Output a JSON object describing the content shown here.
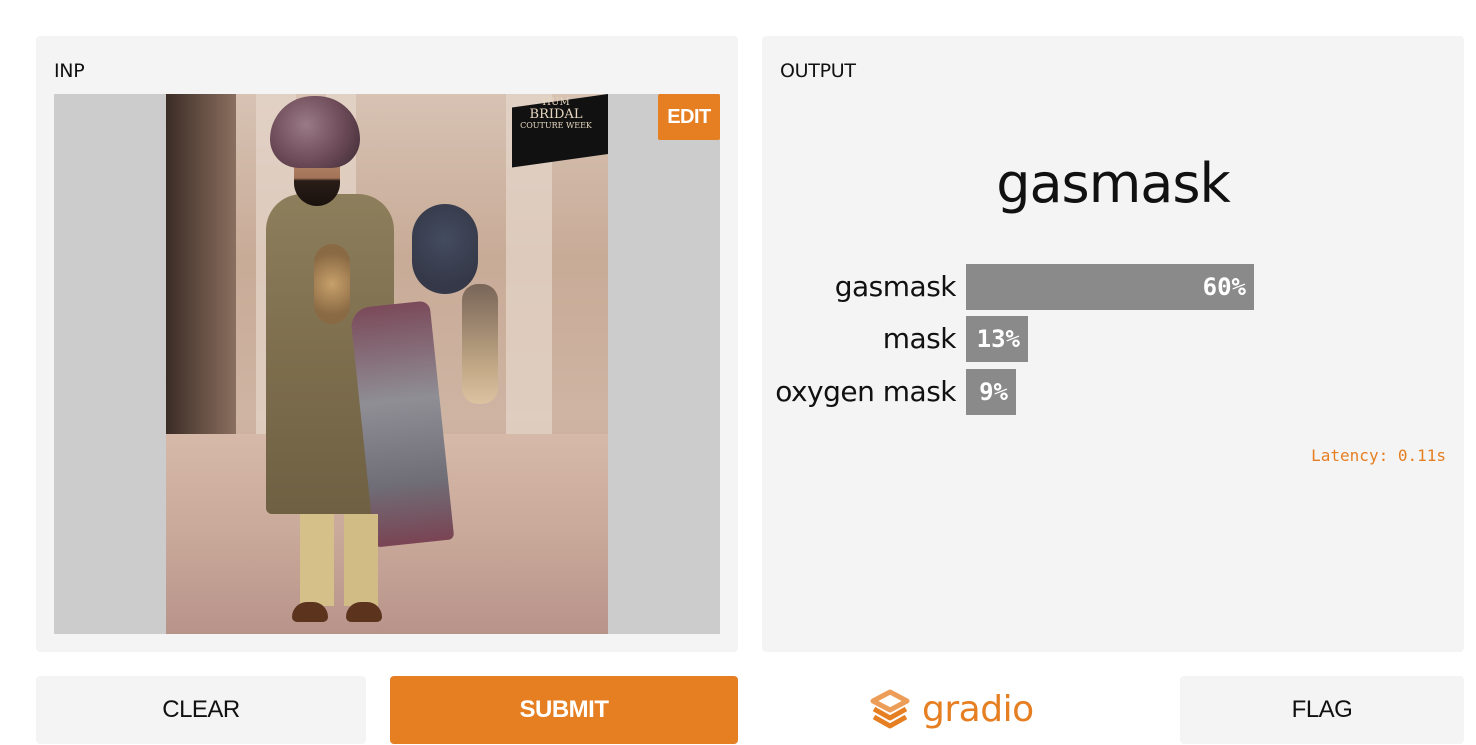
{
  "input_panel": {
    "label": "INP",
    "edit_label": "EDIT",
    "image_badge": {
      "line1": "HUM",
      "line2": "BRIDAL",
      "line3": "COUTURE WEEK"
    }
  },
  "output_panel": {
    "label": "OUTPUT",
    "predicted_label": "gasmask",
    "confidences": [
      {
        "label": "gasmask",
        "percent": "60%",
        "value": 0.6
      },
      {
        "label": "mask",
        "percent": "13%",
        "value": 0.13
      },
      {
        "label": "oxygen mask",
        "percent": "9%",
        "value": 0.09
      }
    ],
    "latency": "Latency: 0.11s"
  },
  "buttons": {
    "clear": "CLEAR",
    "submit": "SUBMIT",
    "flag": "FLAG"
  },
  "branding": {
    "name": "gradio",
    "accent_color": "#e67e22"
  }
}
